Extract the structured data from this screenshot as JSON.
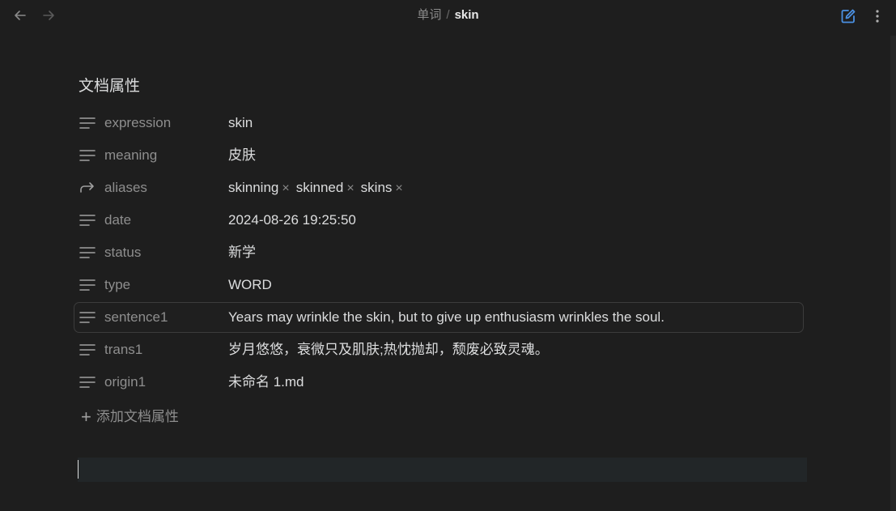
{
  "breadcrumb": {
    "folder": "单词",
    "separator": "/",
    "file": "skin"
  },
  "properties": {
    "heading": "文档属性",
    "rows": [
      {
        "key": "expression",
        "value": "skin",
        "icon": "text-lines-icon"
      },
      {
        "key": "meaning",
        "value": "皮肤",
        "icon": "text-lines-icon"
      },
      {
        "key": "aliases",
        "values": [
          "skinning",
          "skinned",
          "skins"
        ],
        "icon": "forward-arrow-icon"
      },
      {
        "key": "date",
        "value": "2024-08-26 19:25:50",
        "icon": "text-lines-icon"
      },
      {
        "key": "status",
        "value": "新学",
        "icon": "text-lines-icon"
      },
      {
        "key": "type",
        "value": "WORD",
        "icon": "text-lines-icon"
      },
      {
        "key": "sentence1",
        "value": "Years may wrinkle the skin, but to give up enthusiasm wrinkles the soul.",
        "icon": "text-lines-icon"
      },
      {
        "key": "trans1",
        "value": "岁月悠悠，衰微只及肌肤;热忱抛却，颓废必致灵魂。",
        "icon": "text-lines-icon"
      },
      {
        "key": "origin1",
        "value": "未命名 1.md",
        "icon": "text-lines-icon"
      }
    ],
    "add_label": "添加文档属性"
  },
  "colors": {
    "background": "#1e1e1e",
    "text": "#dcddde",
    "muted": "#8e8e8e",
    "accent": "#4a90e2"
  }
}
